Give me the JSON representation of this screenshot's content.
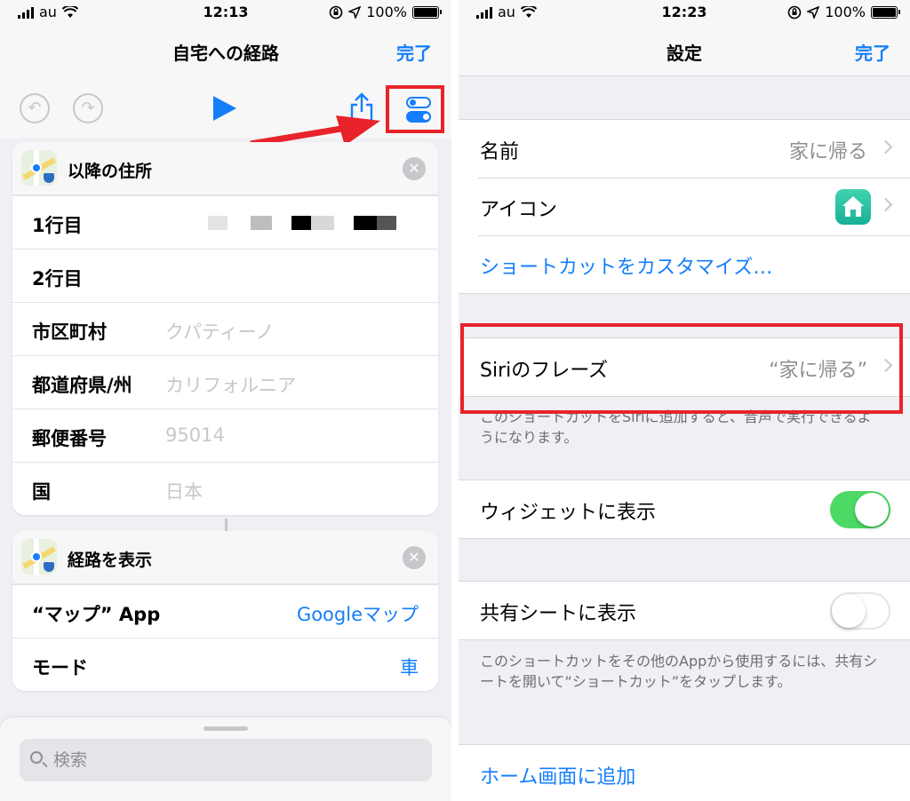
{
  "left": {
    "status": {
      "carrier": "au",
      "time": "12:13",
      "battery": "100%"
    },
    "nav": {
      "title": "自宅への経路",
      "done": "完了"
    },
    "address_card": {
      "title": "以降の住所",
      "rows": [
        {
          "label": "1行目",
          "placeholder": ""
        },
        {
          "label": "2行目",
          "placeholder": ""
        },
        {
          "label": "市区町村",
          "placeholder": "クパティーノ"
        },
        {
          "label": "都道府県/州",
          "placeholder": "カリフォルニア"
        },
        {
          "label": "郵便番号",
          "placeholder": "95014"
        },
        {
          "label": "国",
          "placeholder": "日本"
        }
      ]
    },
    "route_card": {
      "title": "経路を表示",
      "rows": [
        {
          "label": "“マップ” App",
          "value": "Googleマップ"
        },
        {
          "label": "モード",
          "value": "車"
        }
      ]
    },
    "search": {
      "placeholder": "検索"
    },
    "colors": {
      "accent": "#157efb",
      "highlight": "#e8232a"
    }
  },
  "right": {
    "status": {
      "carrier": "au",
      "time": "12:23",
      "battery": "100%"
    },
    "nav": {
      "title": "設定",
      "done": "完了"
    },
    "name_row": {
      "label": "名前",
      "value": "家に帰る"
    },
    "icon_row": {
      "label": "アイコン"
    },
    "customize_link": "ショートカットをカスタマイズ…",
    "siri_row": {
      "label": "Siriのフレーズ",
      "value": "“家に帰る”"
    },
    "siri_note": "このショートカットをSiriに追加すると、音声で実行できるようになります。",
    "widget_row": {
      "label": "ウィジェットに表示",
      "on": true
    },
    "share_row": {
      "label": "共有シートに表示",
      "on": false
    },
    "share_note": "このショートカットをその他のAppから使用するには、共有シートを開いて“ショートカット”をタップします。",
    "add_home": "ホーム画面に追加",
    "colors": {
      "switch_on": "#4cd964",
      "link": "#157efb"
    }
  }
}
